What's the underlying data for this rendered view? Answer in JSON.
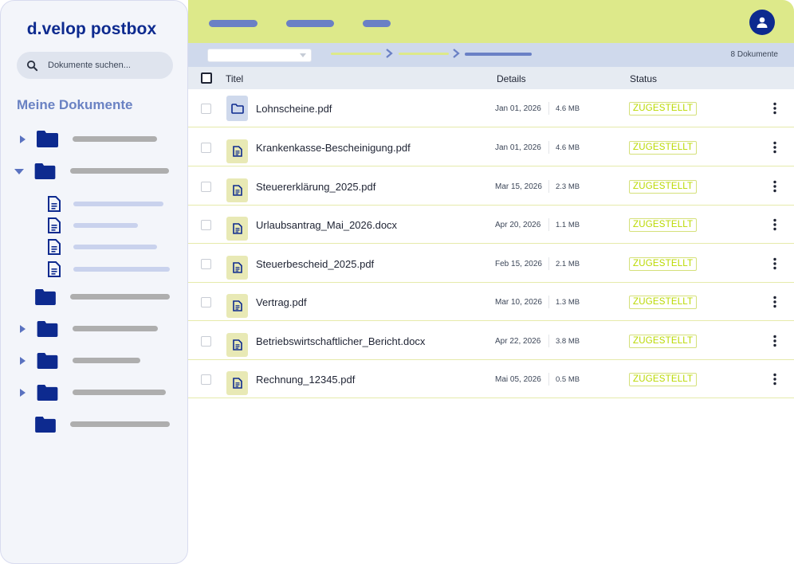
{
  "app": {
    "logo": "d.velop postbox"
  },
  "search": {
    "placeholder": "Dokumente suchen..."
  },
  "sidebar": {
    "section_title": "Meine Dokumente"
  },
  "toolbar": {
    "document_count": "8 Dokumente"
  },
  "table": {
    "columns": {
      "title": "Titel",
      "details": "Details",
      "status": "Status"
    },
    "rows": [
      {
        "title": "Lohnscheine.pdf",
        "date": "Jan 01, 2026",
        "size": "4.6 MB",
        "status": "ZUGESTELLT",
        "icon": "folder-icon"
      },
      {
        "title": "Krankenkasse-Bescheinigung.pdf",
        "date": "Jan 01, 2026",
        "size": "4.6 MB",
        "status": "ZUGESTELLT",
        "icon": "document-icon"
      },
      {
        "title": "Steuererklärung_2025.pdf",
        "date": "Mar 15, 2026",
        "size": "2.3 MB",
        "status": "ZUGESTELLT",
        "icon": "document-icon"
      },
      {
        "title": "Urlaubsantrag_Mai_2026.docx",
        "date": "Apr 20, 2026",
        "size": "1.1 MB",
        "status": "ZUGESTELLT",
        "icon": "document-icon"
      },
      {
        "title": "Steuerbescheid_2025.pdf",
        "date": "Feb 15, 2026",
        "size": "2.1 MB",
        "status": "ZUGESTELLT",
        "icon": "document-icon"
      },
      {
        "title": "Vertrag.pdf",
        "date": "Mar 10, 2026",
        "size": "1.3 MB",
        "status": "ZUGESTELLT",
        "icon": "document-icon"
      },
      {
        "title": "Betriebswirtschaftlicher_Bericht.docx",
        "date": "Apr 22, 2026",
        "size": "3.8 MB",
        "status": "ZUGESTELLT",
        "icon": "document-icon"
      },
      {
        "title": "Rechnung_12345.pdf",
        "date": "Mai 05, 2026",
        "size": "0.5 MB",
        "status": "ZUGESTELLT",
        "icon": "document-icon"
      }
    ]
  },
  "colors": {
    "brand": "#0d2a8f",
    "accent_yellow": "#dde98a",
    "status": "#bad900",
    "nav_pill": "#6a80c5"
  }
}
